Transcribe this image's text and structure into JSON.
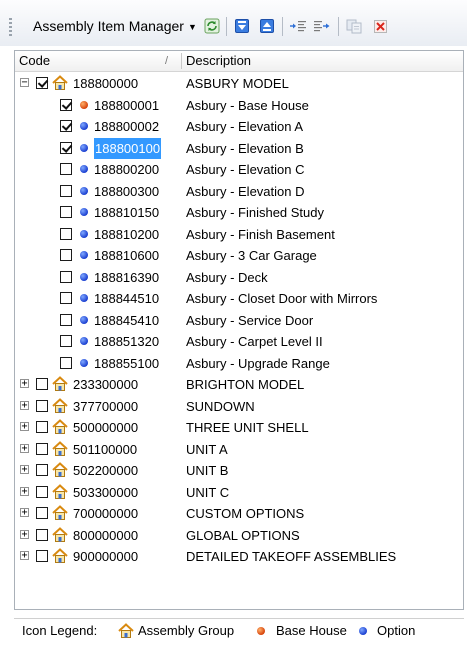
{
  "toolbar": {
    "title": "Assembly Item Manager",
    "buttons": [
      {
        "name": "refresh-icon"
      },
      {
        "name": "move-down-icon"
      },
      {
        "name": "move-up-icon"
      },
      {
        "name": "indent-icon"
      },
      {
        "name": "outdent-icon"
      },
      {
        "name": "copy-icon"
      },
      {
        "name": "delete-icon"
      }
    ]
  },
  "header": {
    "code": "Code",
    "description": "Description",
    "sort_indicator": "/"
  },
  "rows": [
    {
      "level": 0,
      "expander": "−",
      "checked": true,
      "icon": "group",
      "code": "188800000",
      "description": "ASBURY MODEL"
    },
    {
      "level": 1,
      "expander": "",
      "checked": true,
      "icon": "base",
      "code": "188800001",
      "description": "Asbury - Base House"
    },
    {
      "level": 1,
      "expander": "",
      "checked": true,
      "icon": "option",
      "code": "188800002",
      "description": "Asbury - Elevation A"
    },
    {
      "level": 1,
      "expander": "",
      "checked": true,
      "icon": "option",
      "code": "188800100",
      "description": "Asbury - Elevation B",
      "selected": true
    },
    {
      "level": 1,
      "expander": "",
      "checked": false,
      "icon": "option",
      "code": "188800200",
      "description": "Asbury - Elevation C"
    },
    {
      "level": 1,
      "expander": "",
      "checked": false,
      "icon": "option",
      "code": "188800300",
      "description": "Asbury - Elevation D"
    },
    {
      "level": 1,
      "expander": "",
      "checked": false,
      "icon": "option",
      "code": "188810150",
      "description": "Asbury - Finished Study"
    },
    {
      "level": 1,
      "expander": "",
      "checked": false,
      "icon": "option",
      "code": "188810200",
      "description": "Asbury - Finish Basement"
    },
    {
      "level": 1,
      "expander": "",
      "checked": false,
      "icon": "option",
      "code": "188810600",
      "description": "Asbury - 3 Car Garage"
    },
    {
      "level": 1,
      "expander": "",
      "checked": false,
      "icon": "option",
      "code": "188816390",
      "description": "Asbury - Deck"
    },
    {
      "level": 1,
      "expander": "",
      "checked": false,
      "icon": "option",
      "code": "188844510",
      "description": "Asbury - Closet Door with Mirrors"
    },
    {
      "level": 1,
      "expander": "",
      "checked": false,
      "icon": "option",
      "code": "188845410",
      "description": "Asbury - Service Door"
    },
    {
      "level": 1,
      "expander": "",
      "checked": false,
      "icon": "option",
      "code": "188851320",
      "description": "Asbury - Carpet Level II"
    },
    {
      "level": 1,
      "expander": "",
      "checked": false,
      "icon": "option",
      "code": "188855100",
      "description": "Asbury - Upgrade Range"
    },
    {
      "level": 0,
      "expander": "+",
      "checked": false,
      "icon": "group",
      "code": "233300000",
      "description": "BRIGHTON MODEL"
    },
    {
      "level": 0,
      "expander": "+",
      "checked": false,
      "icon": "group",
      "code": "377700000",
      "description": "SUNDOWN"
    },
    {
      "level": 0,
      "expander": "+",
      "checked": false,
      "icon": "group",
      "code": "500000000",
      "description": "THREE  UNIT SHELL"
    },
    {
      "level": 0,
      "expander": "+",
      "checked": false,
      "icon": "group",
      "code": "501100000",
      "description": "UNIT A"
    },
    {
      "level": 0,
      "expander": "+",
      "checked": false,
      "icon": "group",
      "code": "502200000",
      "description": "UNIT B"
    },
    {
      "level": 0,
      "expander": "+",
      "checked": false,
      "icon": "group",
      "code": "503300000",
      "description": "UNIT C"
    },
    {
      "level": 0,
      "expander": "+",
      "checked": false,
      "icon": "group",
      "code": "700000000",
      "description": "CUSTOM OPTIONS"
    },
    {
      "level": 0,
      "expander": "+",
      "checked": false,
      "icon": "group",
      "code": "800000000",
      "description": "GLOBAL OPTIONS"
    },
    {
      "level": 0,
      "expander": "+",
      "checked": false,
      "icon": "group",
      "code": "900000000",
      "description": "DETAILED TAKEOFF ASSEMBLIES"
    }
  ],
  "legend": {
    "label": "Icon Legend:",
    "group": "Assembly Group",
    "base": "Base House",
    "option": "Option"
  },
  "colors": {
    "selection": "#3399ff",
    "option_dot": "#1a3fd0",
    "base_dot": "#d6420a",
    "house_roof": "#e8a020"
  }
}
